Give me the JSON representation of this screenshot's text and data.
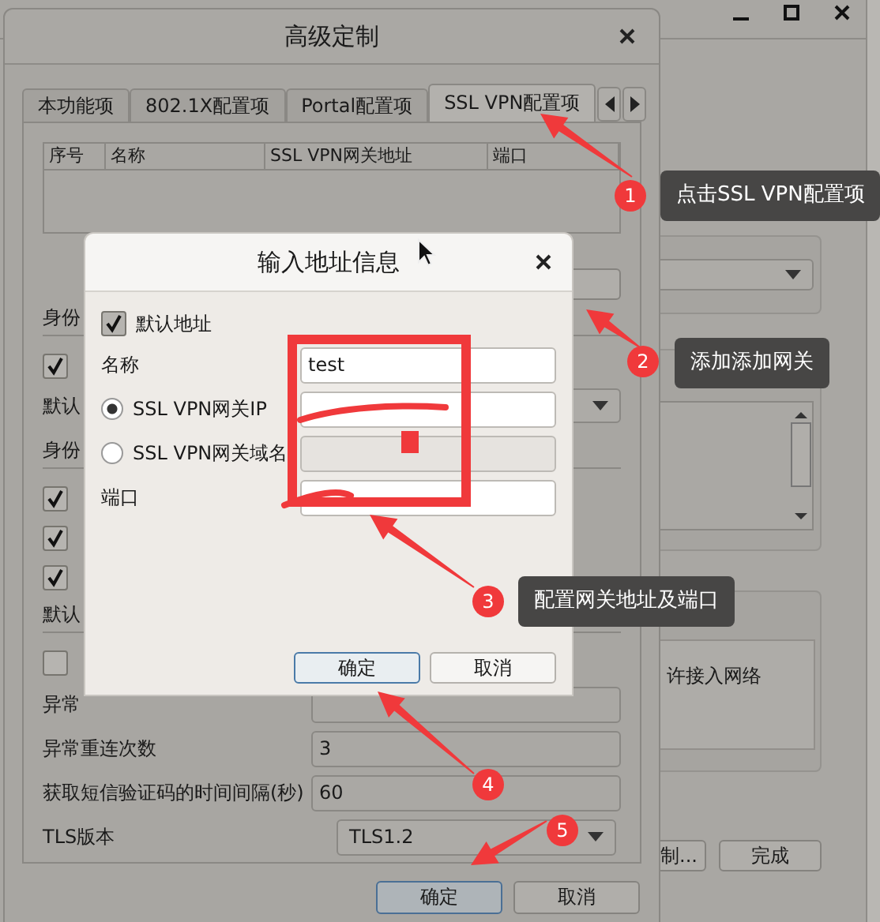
{
  "main_window": {
    "option_text": "许接入网络",
    "buttons": [
      {
        "label": "制..."
      },
      {
        "label": "完成"
      }
    ]
  },
  "dialog": {
    "title": "高级定制",
    "tabs": [
      {
        "label": "本功能项",
        "selected": false
      },
      {
        "label": "802.1X配置项",
        "selected": false
      },
      {
        "label": "Portal配置项",
        "selected": false
      },
      {
        "label": "SSL VPN配置项",
        "selected": true
      }
    ],
    "table": {
      "columns": [
        "序号",
        "名称",
        "SSL VPN网关地址",
        "端口"
      ]
    },
    "items": [
      {
        "kind": "heading",
        "text": "身份"
      },
      {
        "kind": "checkbox",
        "checked": true
      },
      {
        "kind": "combo",
        "text": "默认"
      },
      {
        "kind": "heading",
        "text": "身份"
      },
      {
        "kind": "checkbox",
        "checked": true
      },
      {
        "kind": "checkbox",
        "checked": true
      },
      {
        "kind": "checkbox",
        "checked": true
      },
      {
        "kind": "heading",
        "text": "默认"
      },
      {
        "kind": "checkbox",
        "checked": false
      }
    ],
    "fields": [
      {
        "kind": "text",
        "label": "异常"
      },
      {
        "kind": "text",
        "label": "异常重连次数",
        "value": "3"
      },
      {
        "kind": "text",
        "label": "获取短信验证码的时间间隔(秒)",
        "value": "60"
      },
      {
        "kind": "select",
        "label": "TLS版本",
        "value": "TLS1.2"
      }
    ],
    "buttons": [
      {
        "label": "确定",
        "focused": true
      },
      {
        "label": "取消",
        "focused": false
      }
    ]
  },
  "input_dialog": {
    "title": "输入地址信息",
    "default_address": {
      "label": "默认地址",
      "checked": true
    },
    "name": {
      "label": "名称",
      "value": "test"
    },
    "address_options": [
      {
        "label": "SSL VPN网关IP",
        "selected": true
      },
      {
        "label": "SSL VPN网关域名",
        "selected": false
      }
    ],
    "port": {
      "label": "端口"
    },
    "buttons": [
      {
        "label": "确定",
        "focused": true
      },
      {
        "label": "取消",
        "focused": false
      }
    ]
  },
  "annotations": [
    {
      "number": "1",
      "text": "点击SSL VPN配置项"
    },
    {
      "number": "2",
      "text": "添加添加网关"
    },
    {
      "number": "3",
      "text": "配置网关地址及端口"
    },
    {
      "number": "4"
    },
    {
      "number": "5"
    }
  ]
}
